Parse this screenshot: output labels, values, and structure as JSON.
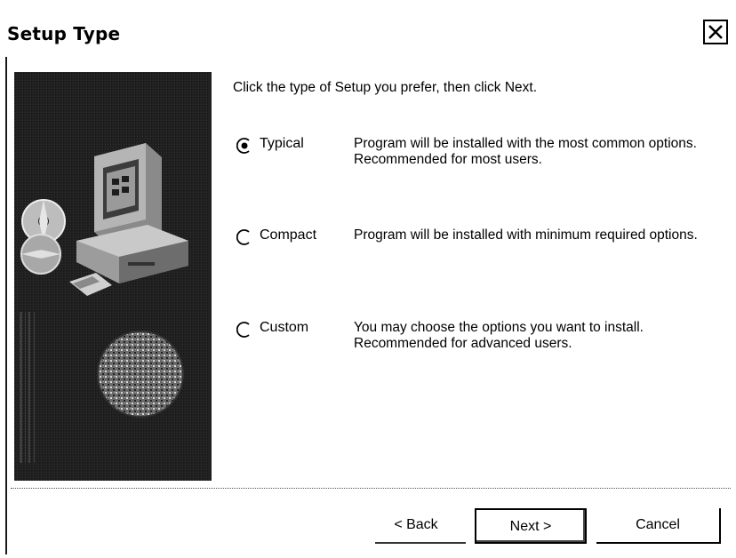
{
  "window": {
    "title": "Setup Type"
  },
  "instruction": "Click the type of Setup you prefer, then click Next.",
  "options": [
    {
      "label": "Typical",
      "description": "Program will be installed with the most common options.  Recommended for most users.",
      "selected": true
    },
    {
      "label": "Compact",
      "description": "Program will be installed with minimum required options.",
      "selected": false
    },
    {
      "label": "Custom",
      "description": "You may choose the options you want to install. Recommended for advanced users.",
      "selected": false
    }
  ],
  "buttons": {
    "back": "< Back",
    "next": "Next >",
    "cancel": "Cancel"
  },
  "icons": {
    "close": "close-icon",
    "radio": "radio-icon"
  },
  "colors": {
    "background": "#ffffff",
    "panel": "#101010",
    "text": "#000000"
  }
}
